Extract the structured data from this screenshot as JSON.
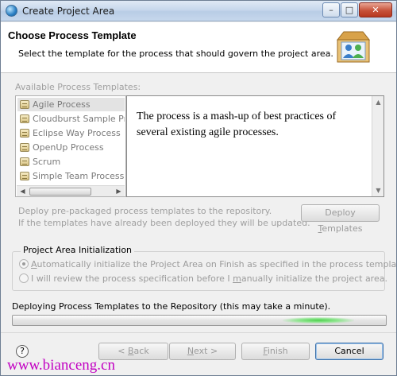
{
  "window": {
    "title": "Create Project Area",
    "controls": {
      "minimize": "–",
      "maximize": "□",
      "close": "✕"
    }
  },
  "header": {
    "title": "Choose Process Template",
    "description": "Select the template for the process that should govern the project area.",
    "icon": "project-area-users-icon"
  },
  "templates": {
    "label": "Available Process Templates:",
    "items": [
      {
        "label": "Agile Process",
        "selected": true
      },
      {
        "label": "Cloudburst Sample Pro",
        "selected": false
      },
      {
        "label": "Eclipse Way Process",
        "selected": false
      },
      {
        "label": "OpenUp Process",
        "selected": false
      },
      {
        "label": "Scrum",
        "selected": false
      },
      {
        "label": "Simple Team Process",
        "selected": false
      }
    ],
    "description": "The process is a mash-up of best practices of several existing agile processes."
  },
  "deploy": {
    "hint_line1": "Deploy pre-packaged process templates to the repository.",
    "hint_line2": "If the templates have already been deployed they will be updated.",
    "button_label_pre": "Deploy ",
    "button_label_mnemonic": "T",
    "button_label_post": "emplates"
  },
  "initialization": {
    "title": "Project Area Initialization",
    "option1_mnemonic": "A",
    "option1_rest": "utomatically initialize the Project Area on Finish as specified in the process template.",
    "option2_pre": "I will review the process specification before I ",
    "option2_mnemonic": "m",
    "option2_rest": "anually initialize the project area.",
    "selected": 1
  },
  "progress": {
    "label": "Deploying Process Templates to the Repository (this may take a minute).",
    "indeterminate": true,
    "accent": "#4dd14d"
  },
  "buttons": {
    "back_pre": "< ",
    "back_mnemonic": "B",
    "back_post": "ack",
    "next_mnemonic": "N",
    "next_post": "ext >",
    "finish_mnemonic": "F",
    "finish_post": "inish",
    "cancel": "Cancel",
    "help": "?"
  },
  "watermark": "www.bianceng.cn"
}
